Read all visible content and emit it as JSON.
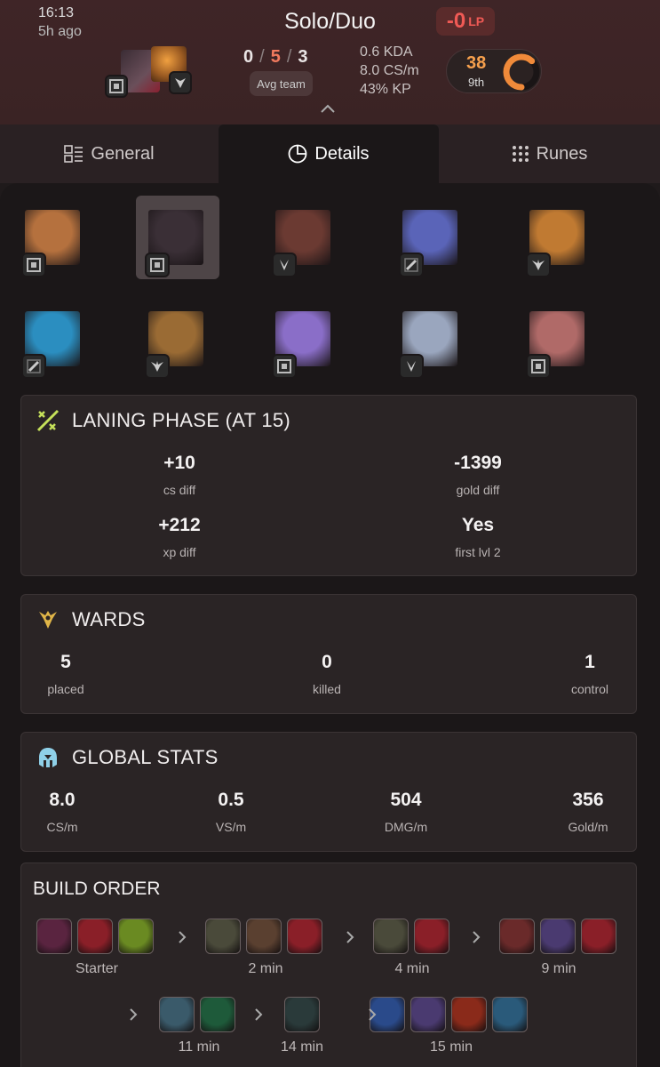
{
  "header": {
    "time": "16:13",
    "ago": "5h ago",
    "mode": "Solo/Duo",
    "kda": {
      "k": "0",
      "d": "5",
      "a": "3",
      "sep": "/"
    },
    "avg_team": "Avg team",
    "kda_ratio": "0.6 KDA",
    "cs_per_min": "8.0 CS/m",
    "kp": "43% KP",
    "lp_value": "-0",
    "lp_unit": "LP",
    "score": "38",
    "placement": "9th",
    "score_progress": 0.62
  },
  "tabs": [
    {
      "label": "General",
      "icon": "grid-icon"
    },
    {
      "label": "Details",
      "icon": "pie-chart-icon"
    },
    {
      "label": "Runes",
      "icon": "dots-grid-icon"
    }
  ],
  "players": {
    "team1": [
      {
        "role": "top",
        "color": "#b5713e",
        "selected": false
      },
      {
        "role": "top",
        "color": "#3a2f36",
        "selected": true
      },
      {
        "role": "jungle",
        "color": "#6b3a32",
        "selected": false
      },
      {
        "role": "mid",
        "color": "#5a64b8",
        "selected": false
      },
      {
        "role": "support",
        "color": "#c07a32",
        "selected": false
      }
    ],
    "team2": [
      {
        "role": "mid",
        "color": "#2b8ec0",
        "selected": false
      },
      {
        "role": "support",
        "color": "#9a6b34",
        "selected": false
      },
      {
        "role": "top",
        "color": "#8a6ec8",
        "selected": false
      },
      {
        "role": "jungle",
        "color": "#9aa6be",
        "selected": false
      },
      {
        "role": "top",
        "color": "#b06a68",
        "selected": false
      }
    ]
  },
  "laning": {
    "title": "LANING PHASE (AT 15)",
    "stats": [
      {
        "value": "+10",
        "label": "cs diff"
      },
      {
        "value": "-1399",
        "label": "gold diff"
      },
      {
        "value": "+212",
        "label": "xp diff"
      },
      {
        "value": "Yes",
        "label": "first lvl 2"
      }
    ]
  },
  "wards": {
    "title": "WARDS",
    "stats": [
      {
        "value": "5",
        "label": "placed"
      },
      {
        "value": "0",
        "label": "killed"
      },
      {
        "value": "1",
        "label": "control"
      }
    ]
  },
  "global": {
    "title": "GLOBAL STATS",
    "stats": [
      {
        "value": "8.0",
        "label": "CS/m"
      },
      {
        "value": "0.5",
        "label": "VS/m"
      },
      {
        "value": "504",
        "label": "DMG/m"
      },
      {
        "value": "356",
        "label": "Gold/m"
      }
    ]
  },
  "build": {
    "title": "BUILD ORDER",
    "groups": [
      {
        "time": "Starter",
        "items": [
          {
            "icon": "long-sword-icon",
            "color": "#5a2440"
          },
          {
            "icon": "health-potion-icon",
            "color": "#8a1f28"
          },
          {
            "icon": "stealth-ward-icon",
            "color": "#6a8a22"
          }
        ]
      },
      {
        "time": "2 min",
        "items": [
          {
            "icon": "serrated-dirk-icon",
            "color": "#4a4a3a"
          },
          {
            "icon": "boots-icon",
            "color": "#5a4030"
          },
          {
            "icon": "health-potion-icon",
            "color": "#8a1f28"
          }
        ]
      },
      {
        "time": "4 min",
        "items": [
          {
            "icon": "serrated-dirk-icon",
            "color": "#4a4a3a"
          },
          {
            "icon": "health-potion-icon",
            "color": "#8a1f28"
          }
        ]
      },
      {
        "time": "9 min",
        "items": [
          {
            "icon": "plated-boots-icon",
            "color": "#6a2a2a"
          },
          {
            "icon": "cloak-icon",
            "color": "#4a3a70"
          },
          {
            "icon": "health-potion-icon",
            "color": "#8a1f28"
          }
        ]
      },
      {
        "time": "11 min",
        "items": [
          {
            "icon": "vampiric-axe-icon",
            "color": "#3a5a6a"
          },
          {
            "icon": "elixir-icon",
            "color": "#1e5a3a"
          }
        ]
      },
      {
        "time": "14 min",
        "items": [
          {
            "icon": "pickaxe-icon",
            "color": "#2a3a3a"
          }
        ]
      },
      {
        "time": "15 min",
        "items": [
          {
            "icon": "cannon-icon",
            "color": "#2a4a8a"
          },
          {
            "icon": "cloak-icon",
            "color": "#4a3a70"
          },
          {
            "icon": "hydra-icon",
            "color": "#8a2a1a"
          },
          {
            "icon": "orb-icon",
            "color": "#2a5a7a"
          }
        ]
      }
    ]
  }
}
